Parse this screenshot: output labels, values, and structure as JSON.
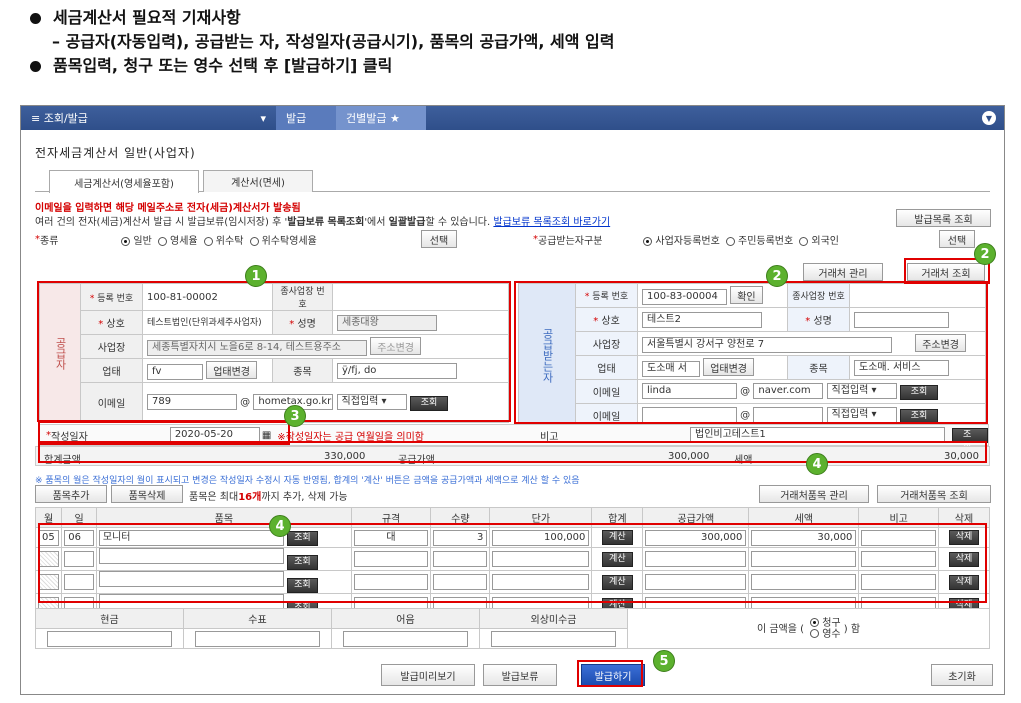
{
  "bullets": {
    "line1": "세금계산서 필요적 기재사항",
    "line2": "– 공급자(자동입력), 공급받는 자, 작성일자(공급시기), 품목의 공급가액, 세액 입력",
    "line3": "품목입력, 청구 또는 영수 선택 후 [발급하기] 클릭"
  },
  "topbar": {
    "menu": "≡  조회/발급",
    "arrow": "▾",
    "crumb1": "발급",
    "crumb2": "건별발급  ★"
  },
  "page_title": "전자세금계산서 일반(사업자)",
  "tabs": [
    "세금계산서(영세율포함)",
    "계산서(면세)"
  ],
  "notice": {
    "line1": "이메일을 입력하면 해당 메일주소로 전자(세금)계산서가 발송됨",
    "line2_a": "여러 건의 전자(세금)계산서 발급 시 발급보류(임시저장) 후 '",
    "line2_b": "발급보류 목록조회",
    "line2_c": "'에서 ",
    "line2_d": "일괄발급",
    "line2_e": "할 수 있습니다.",
    "link": "발급보류 목록조회 바로가기"
  },
  "buttons": {
    "issue_list": "발급목록 조회",
    "select": "선택",
    "partner_manage": "거래처 관리",
    "partner_search": "거래처 조회",
    "confirm": "확인",
    "industry_change": "업태변경",
    "address_change": "주소변경",
    "search": "조회",
    "add_item": "품목추가",
    "delete_item": "품목삭제",
    "partner_item_manage": "거래처품목 관리",
    "partner_item_search": "거래처품목 조회",
    "calc": "계산",
    "delete": "삭제",
    "preview": "발급미리보기",
    "hold": "발급보류",
    "issue": "발급하기",
    "reset": "초기화"
  },
  "type_row": {
    "label": "종류",
    "options": [
      "일반",
      "영세율",
      "위수탁",
      "위수탁영세율"
    ],
    "recv_label": "공급받는자구분",
    "recv_options": [
      "사업자등록번호",
      "주민등록번호",
      "외국인"
    ]
  },
  "supplier": {
    "side_label": "공급자",
    "reg_label": "등록\n번호",
    "reg": "100-81-00002",
    "sub_label": "종사업장\n번호",
    "name_label": "상호",
    "name": "테스트법인(단위과세주사업자)",
    "rep_label": "성명",
    "rep": "세종대왕",
    "addr_label": "사업장",
    "addr": "세종특별자치시 노을6로 8-14, 테스트용주소",
    "biz_label": "업태",
    "biz": "fv",
    "item_label": "종목",
    "item": "ÿ/fj, do",
    "email_label": "이메일",
    "email_id": "789",
    "email_domain": "hometax.go.kr",
    "direct": "직접입력"
  },
  "receiver": {
    "side_label": "공급받는자",
    "reg_label": "등록\n번호",
    "reg": "100-83-00004",
    "sub_label": "종사업장\n번호",
    "name_label": "상호",
    "name": "테스트2",
    "rep_label": "성명",
    "addr_label": "사업장",
    "addr": "서울특별시 강서구 양천로 7",
    "biz_label": "업태",
    "biz": "도소매 서",
    "item_label": "종목",
    "item": "도소매. 서비스",
    "email_label": "이메일",
    "email_id": "linda",
    "email_domain": "naver.com",
    "email2_label": "이메일",
    "direct": "직접입력"
  },
  "write_date": {
    "label": "작성일자",
    "value": "2020-05-20",
    "note": "※작성일자는 공급 연월일을 의미함",
    "remark_label": "비고",
    "remark": "법인비고테스트1"
  },
  "totals": {
    "total_label": "합계금액",
    "total": "330,000",
    "supply_label": "공급가액",
    "supply": "300,000",
    "tax_label": "세액",
    "tax": "30,000"
  },
  "item_note": "※ 품목의 월은 작성일자의 월이 표시되고 변경은 작성일자 수정시 자동 반영됨, 합계의 '계산' 버튼은 금액을 공급가액과 세액으로 계산 할 수 있음",
  "item_limit_a": "품목은 최대 ",
  "item_limit_b": "16개",
  "item_limit_c": "까지 추가, 삭제 가능",
  "item_headers": [
    "월",
    "일",
    "품목",
    "규격",
    "수량",
    "단가",
    "합계",
    "공급가액",
    "세액",
    "비고",
    "삭제"
  ],
  "items": [
    {
      "month": "05",
      "day": "06",
      "name": "모니터",
      "spec": "대",
      "qty": "3",
      "price": "100,000",
      "supply": "300,000",
      "tax": "30,000"
    }
  ],
  "payment": {
    "headers": [
      "현금",
      "수표",
      "어음",
      "외상미수금"
    ],
    "claim_prefix": "이 금액을 (",
    "claim": "청구",
    "receipt": "영수",
    "claim_suffix": ") 함"
  },
  "markers": [
    "1",
    "2",
    "3",
    "4",
    "4",
    "5"
  ]
}
